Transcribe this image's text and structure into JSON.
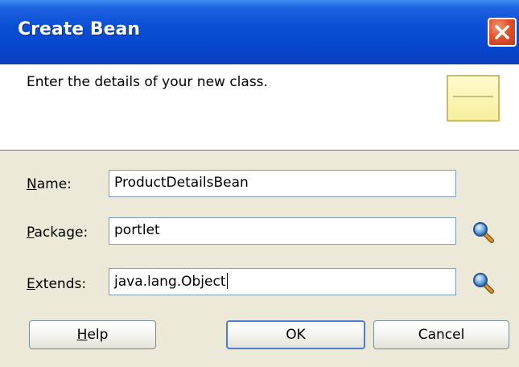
{
  "dialog": {
    "title": "Create Bean",
    "header_text": "Enter the details of your new class."
  },
  "form": {
    "name": {
      "label_mnemonic": "N",
      "label_rest": "ame:",
      "value": "ProductDetailsBean"
    },
    "package": {
      "label_mnemonic": "P",
      "label_rest": "ackage:",
      "value": "portlet"
    },
    "extends": {
      "label_mnemonic": "E",
      "label_rest": "xtends:",
      "value": "java.lang.Object"
    }
  },
  "buttons": {
    "help_mnemonic": "H",
    "help_rest": "elp",
    "ok": "OK",
    "cancel": "Cancel"
  },
  "icons": {
    "close": "close-icon",
    "class": "class-icon",
    "lookup": "magnifier-icon"
  },
  "colors": {
    "titlebar": "#0a4fd6",
    "close": "#e0522a",
    "dialog_bg": "#ece9d8"
  }
}
